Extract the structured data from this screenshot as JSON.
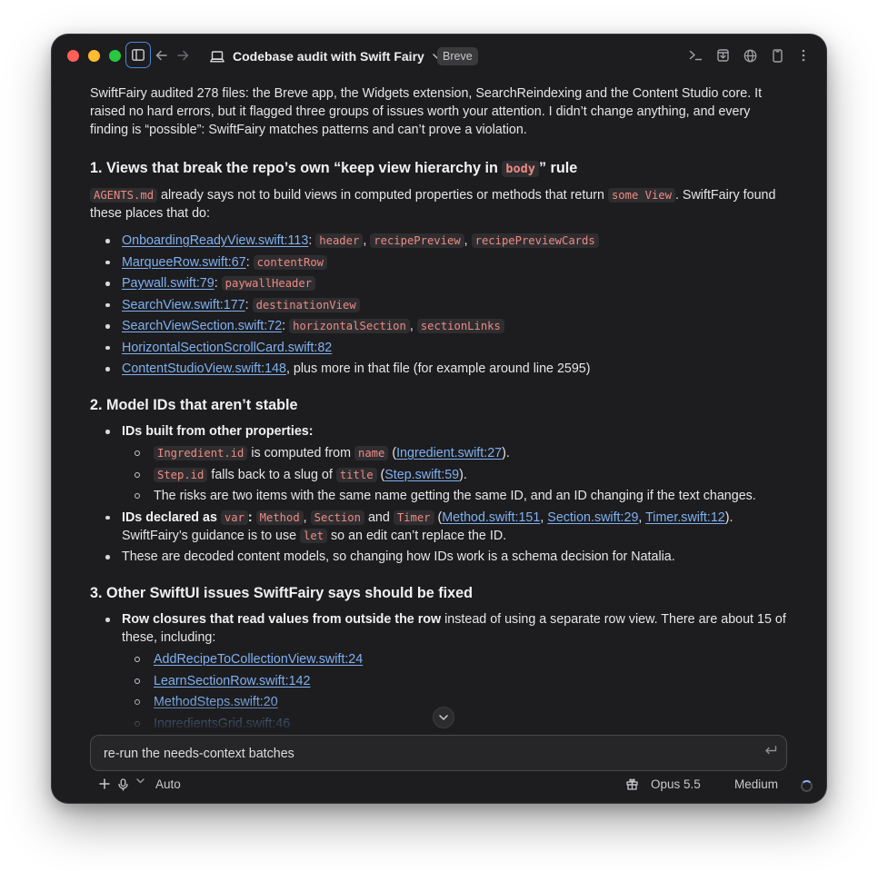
{
  "titlebar": {
    "thread_title": "Codebase audit with Swift Fairy",
    "project_badge": "Breve"
  },
  "intro": "SwiftFairy audited 278 files: the Breve app, the Widgets extension, SearchReindexing and the Content Studio core. It raised no hard errors, but it flagged three groups of issues worth your attention. I didn’t change anything, and every finding is “possible”: SwiftFairy matches patterns and can’t prove a violation.",
  "section1": {
    "heading_pre": "1. Views that break the repo’s own “keep view hierarchy in ",
    "heading_code": "body",
    "heading_post": "” rule",
    "para_code1": "AGENTS.md",
    "para_text1": " already says not to build views in computed properties or methods that return ",
    "para_code2": "some View",
    "para_text2": ". SwiftFairy found these places that do:",
    "items": [
      {
        "link": "OnboardingReadyView.swift:113",
        "sep": ": ",
        "codes": [
          "header",
          "recipePreview",
          "recipePreviewCards"
        ],
        "tail": ""
      },
      {
        "link": "MarqueeRow.swift:67",
        "sep": ": ",
        "codes": [
          "contentRow"
        ],
        "tail": ""
      },
      {
        "link": "Paywall.swift:79",
        "sep": ": ",
        "codes": [
          "paywallHeader"
        ],
        "tail": ""
      },
      {
        "link": "SearchView.swift:177",
        "sep": ": ",
        "codes": [
          "destinationView"
        ],
        "tail": ""
      },
      {
        "link": "SearchViewSection.swift:72",
        "sep": ": ",
        "codes": [
          "horizontalSection",
          "sectionLinks"
        ],
        "tail": ""
      },
      {
        "link": "HorizontalSectionScrollCard.swift:82",
        "sep": "",
        "codes": [],
        "tail": ""
      },
      {
        "link": "ContentStudioView.swift:148",
        "sep": "",
        "codes": [],
        "tail": ", plus more in that file (for example around line 2595)"
      }
    ]
  },
  "section2": {
    "heading": "2. Model IDs that aren’t stable",
    "ids_built_label": "IDs built from other properties:",
    "sub1_code": "Ingredient.id",
    "sub1_text": " is computed from ",
    "sub1_code2": "name",
    "sub1_link": "Ingredient.swift:27",
    "sub2_code": "Step.id",
    "sub2_text": " falls back to a slug of ",
    "sub2_code2": "title",
    "sub2_link": "Step.swift:59",
    "sub3_text": "The risks are two items with the same name getting the same ID, and an ID changing if the text changes.",
    "declared_label": "IDs declared as ",
    "declared_code_var": "var",
    "declared_code_method": "Method",
    "declared_code_section": "Section",
    "declared_and": " and ",
    "declared_code_timer": "Timer",
    "declared_link1": "Method.swift:151",
    "declared_link2": "Section.swift:29",
    "declared_link3": "Timer.swift:12",
    "declared_guidance_pre": "SwiftFairy’s guidance is to use ",
    "declared_code_let": "let",
    "declared_guidance_post": " so an edit can’t replace the ID.",
    "decoded_text": "These are decoded content models, so changing how IDs work is a schema decision for Natalia."
  },
  "section3": {
    "heading": "3. Other SwiftUI issues SwiftFairy says should be fixed",
    "row_bold": "Row closures that read values from outside the row",
    "row_text": " instead of using a separate row view. There are about 15 of these, including:",
    "row_links": [
      "AddRecipeToCollectionView.swift:24",
      "LearnSectionRow.swift:142",
      "MethodSteps.swift:20",
      "IngredientsGrid.swift:46"
    ]
  },
  "composer": {
    "value": "re-run the needs-context batches"
  },
  "footer": {
    "mode": "Auto",
    "model": "Opus 5.5",
    "effort": "Medium"
  },
  "colors": {
    "window_bg": "#1d1d1f",
    "link": "#7fb0f1",
    "code_text": "#f08a82",
    "code_bg": "#2e2e31",
    "accent_outline": "#4a88d8"
  }
}
